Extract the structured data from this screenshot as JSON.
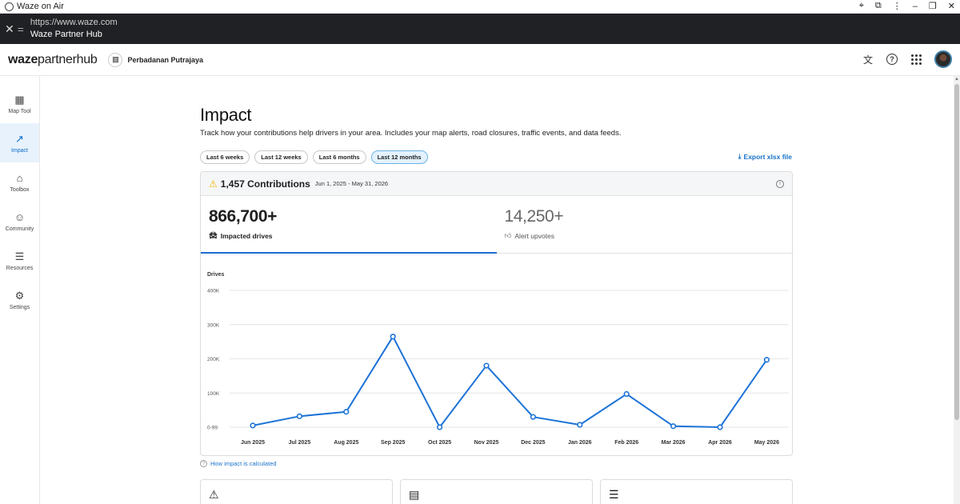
{
  "window": {
    "title": "Waze on Air",
    "url": "https://www.waze.com",
    "page_title": "Waze Partner Hub"
  },
  "header": {
    "brand_bold": "waze",
    "brand_rest": "partnerhub",
    "org_name": "Perbadanan Putrajaya"
  },
  "sidebar": {
    "items": [
      {
        "label": "Map Tool",
        "icon": "map-tool-icon",
        "glyph": "▦"
      },
      {
        "label": "Impact",
        "icon": "impact-icon",
        "glyph": "↗"
      },
      {
        "label": "Toolbox",
        "icon": "toolbox-icon",
        "glyph": "⌂"
      },
      {
        "label": "Community",
        "icon": "community-icon",
        "glyph": "☺"
      },
      {
        "label": "Resources",
        "icon": "resources-icon",
        "glyph": "☰"
      },
      {
        "label": "Settings",
        "icon": "settings-icon",
        "glyph": "⚙"
      }
    ]
  },
  "page": {
    "title": "Impact",
    "description": "Track how your contributions help drivers in your area. Includes your map alerts, road closures, traffic events, and data feeds.",
    "filters": [
      "Last 6 weeks",
      "Last 12 weeks",
      "Last 6 months",
      "Last 12 months"
    ],
    "selected_filter": "Last 12 months",
    "export_label": "Export xlsx file",
    "contributions": "1,457 Contributions",
    "date_range": "Jun 1, 2025 - May 31, 2026",
    "metrics": [
      {
        "value": "866,700+",
        "label": "Impacted drives"
      },
      {
        "value": "14,250+",
        "label": "Alert upvotes"
      }
    ],
    "how_link": "How impact is calculated"
  },
  "colors": {
    "accent": "#1b6fd0",
    "line": "#1d73d6",
    "warning": "#f0b400"
  },
  "chart_data": {
    "type": "line",
    "title": "",
    "ylabel": "Drives",
    "xlabel": "",
    "categories": [
      "Jun 2025",
      "Jul 2025",
      "Aug 2025",
      "Sep 2025",
      "Oct 2025",
      "Nov 2025",
      "Dec 2025",
      "Jan 2026",
      "Feb 2026",
      "Mar 2026",
      "Apr 2026",
      "May 2026"
    ],
    "series": [
      {
        "values": [
          5000,
          32000,
          45000,
          265000,
          0,
          180000,
          30000,
          7000,
          97000,
          3000,
          0,
          197000
        ]
      }
    ],
    "yticks": [
      "0-99",
      "100K",
      "200K",
      "300K",
      "400K"
    ],
    "ylim": [
      0,
      400000
    ],
    "grid": true
  }
}
